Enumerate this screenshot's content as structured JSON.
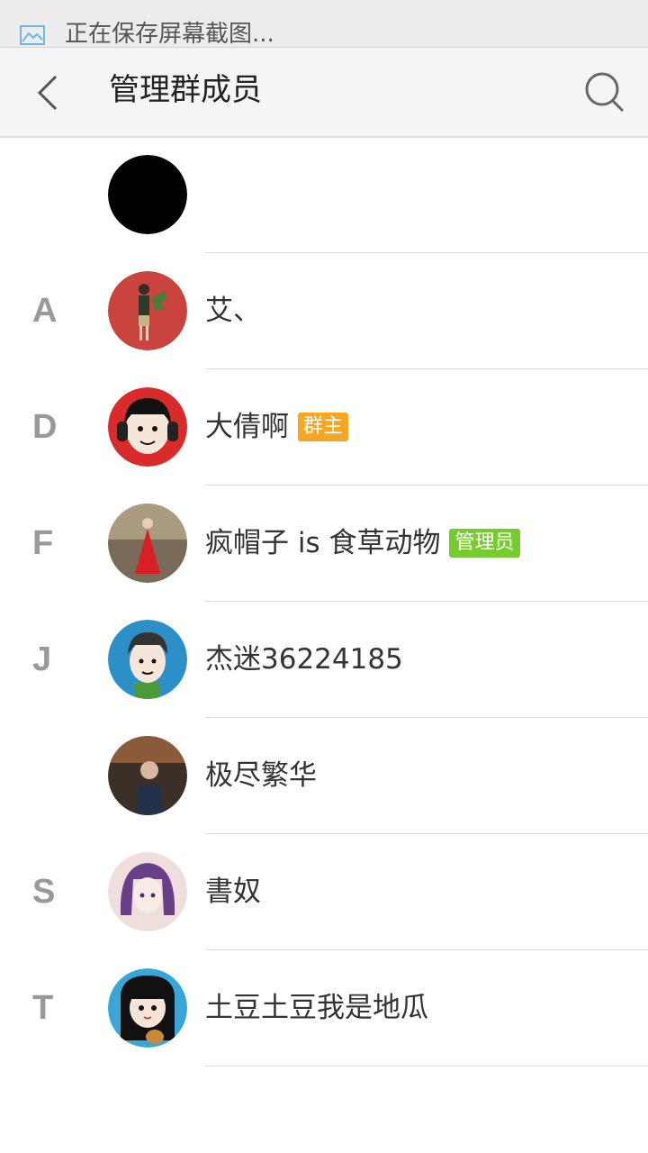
{
  "notification": {
    "text": "正在保存屏幕截图..."
  },
  "header": {
    "title": "管理群成员"
  },
  "members": [
    {
      "letter": "",
      "name": "",
      "badge": "",
      "avatar": "black-avatar"
    },
    {
      "letter": "A",
      "name": "艾、",
      "badge": "",
      "avatar": "girl-plant-avatar"
    },
    {
      "letter": "D",
      "name": "大倩啊",
      "badge": "群主",
      "avatar": "cartoon-headphones-avatar"
    },
    {
      "letter": "F",
      "name": "疯帽子 is 食草动物",
      "badge": "管理员",
      "avatar": "red-dress-avatar"
    },
    {
      "letter": "J",
      "name": "杰迷36224185",
      "badge": "",
      "avatar": "cartoon-boy-avatar"
    },
    {
      "letter": "",
      "name": "极尽繁华",
      "badge": "",
      "avatar": "photo-boy-avatar"
    },
    {
      "letter": "S",
      "name": "書奴",
      "badge": "",
      "avatar": "anime-girl-avatar"
    },
    {
      "letter": "T",
      "name": "土豆土豆我是地瓜",
      "badge": "",
      "avatar": "cartoon-girl-guitar-avatar"
    }
  ],
  "colors": {
    "owner_badge": "#f5a623",
    "admin_badge": "#76cc2e",
    "letter": "#999999"
  }
}
